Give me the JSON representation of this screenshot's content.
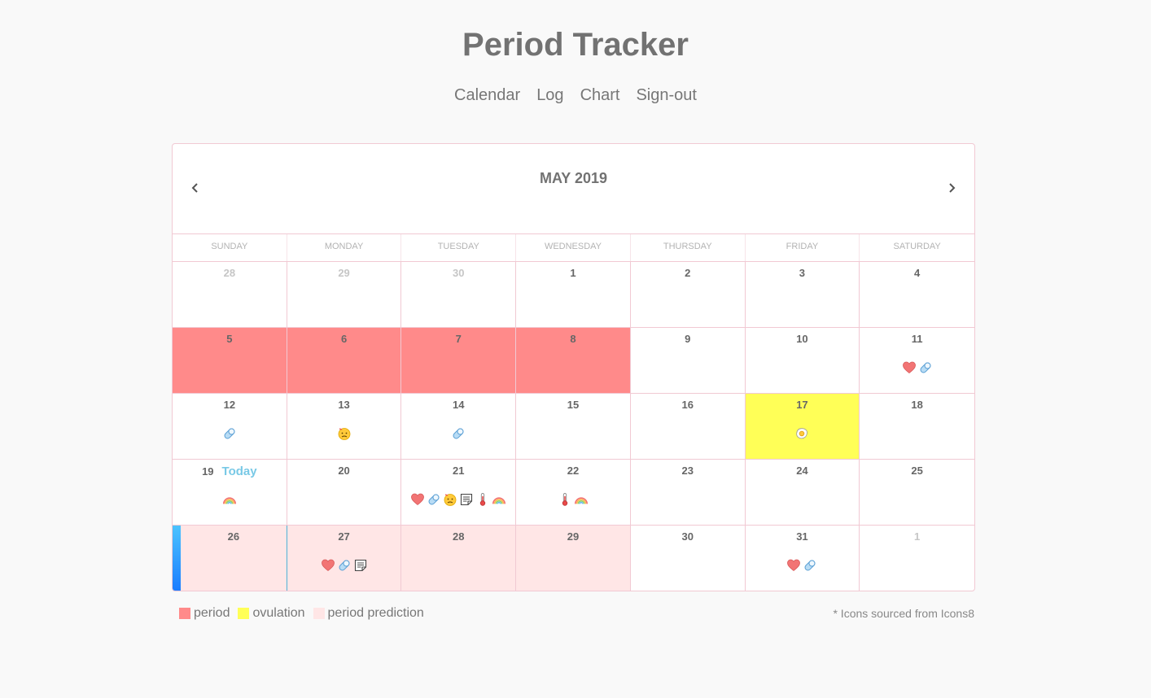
{
  "app": {
    "title": "Period Tracker"
  },
  "nav": [
    {
      "label": "Calendar"
    },
    {
      "label": "Log"
    },
    {
      "label": "Chart"
    },
    {
      "label": "Sign-out"
    }
  ],
  "calendar": {
    "month_label": "MAY 2019",
    "weekdays": [
      "SUNDAY",
      "MONDAY",
      "TUESDAY",
      "WEDNESDAY",
      "THURSDAY",
      "FRIDAY",
      "SATURDAY"
    ],
    "today_label": "Today",
    "colors": {
      "period": "#ff8a8a",
      "ovulation": "#ffff57",
      "prediction": "#ffe6e6",
      "today": "#79c9e6"
    },
    "days": [
      {
        "day": "28",
        "other": true,
        "icons": []
      },
      {
        "day": "29",
        "other": true,
        "icons": []
      },
      {
        "day": "30",
        "other": true,
        "icons": []
      },
      {
        "day": "1",
        "icons": []
      },
      {
        "day": "2",
        "icons": []
      },
      {
        "day": "3",
        "icons": []
      },
      {
        "day": "4",
        "icons": []
      },
      {
        "day": "5",
        "state": "period",
        "icons": []
      },
      {
        "day": "6",
        "state": "period",
        "icons": []
      },
      {
        "day": "7",
        "state": "period",
        "icons": []
      },
      {
        "day": "8",
        "state": "period",
        "icons": []
      },
      {
        "day": "9",
        "icons": []
      },
      {
        "day": "10",
        "icons": []
      },
      {
        "day": "11",
        "icons": [
          "heart",
          "pill"
        ]
      },
      {
        "day": "12",
        "icons": [
          "pill"
        ]
      },
      {
        "day": "13",
        "icons": [
          "sick-face"
        ]
      },
      {
        "day": "14",
        "icons": [
          "pill"
        ]
      },
      {
        "day": "15",
        "icons": []
      },
      {
        "day": "16",
        "icons": []
      },
      {
        "day": "17",
        "state": "ovulation",
        "icons": [
          "egg"
        ]
      },
      {
        "day": "18",
        "icons": []
      },
      {
        "day": "19",
        "today": true,
        "icons": [
          "rainbow"
        ]
      },
      {
        "day": "20",
        "icons": []
      },
      {
        "day": "21",
        "icons": [
          "heart",
          "pill",
          "sick-face",
          "note",
          "thermometer",
          "rainbow"
        ]
      },
      {
        "day": "22",
        "icons": [
          "thermometer",
          "rainbow"
        ]
      },
      {
        "day": "23",
        "icons": []
      },
      {
        "day": "24",
        "icons": []
      },
      {
        "day": "25",
        "icons": []
      },
      {
        "day": "26",
        "state": "prediction",
        "selected": true,
        "icons": []
      },
      {
        "day": "27",
        "state": "prediction",
        "icons": [
          "heart",
          "pill",
          "note"
        ]
      },
      {
        "day": "28",
        "state": "prediction",
        "icons": []
      },
      {
        "day": "29",
        "state": "prediction",
        "icons": []
      },
      {
        "day": "30",
        "icons": []
      },
      {
        "day": "31",
        "icons": [
          "heart",
          "pill"
        ]
      },
      {
        "day": "1",
        "other": true,
        "icons": []
      }
    ]
  },
  "legend": [
    {
      "label": "period",
      "color": "#ff8a8a"
    },
    {
      "label": "ovulation",
      "color": "#ffff57"
    },
    {
      "label": "period prediction",
      "color": "#ffe6e6"
    }
  ],
  "credit": "* Icons sourced from Icons8"
}
